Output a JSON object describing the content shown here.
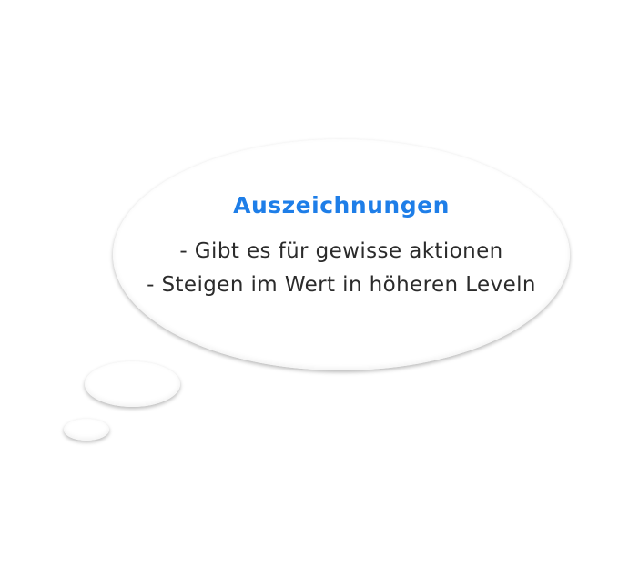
{
  "thought_bubble": {
    "title": "Auszeichnungen",
    "lines": [
      "- Gibt es für gewisse aktionen",
      "- Steigen im Wert in höheren Leveln"
    ]
  },
  "colors": {
    "title": "#1e7ee8",
    "text": "#2b2b2b",
    "background": "#ffffff"
  }
}
